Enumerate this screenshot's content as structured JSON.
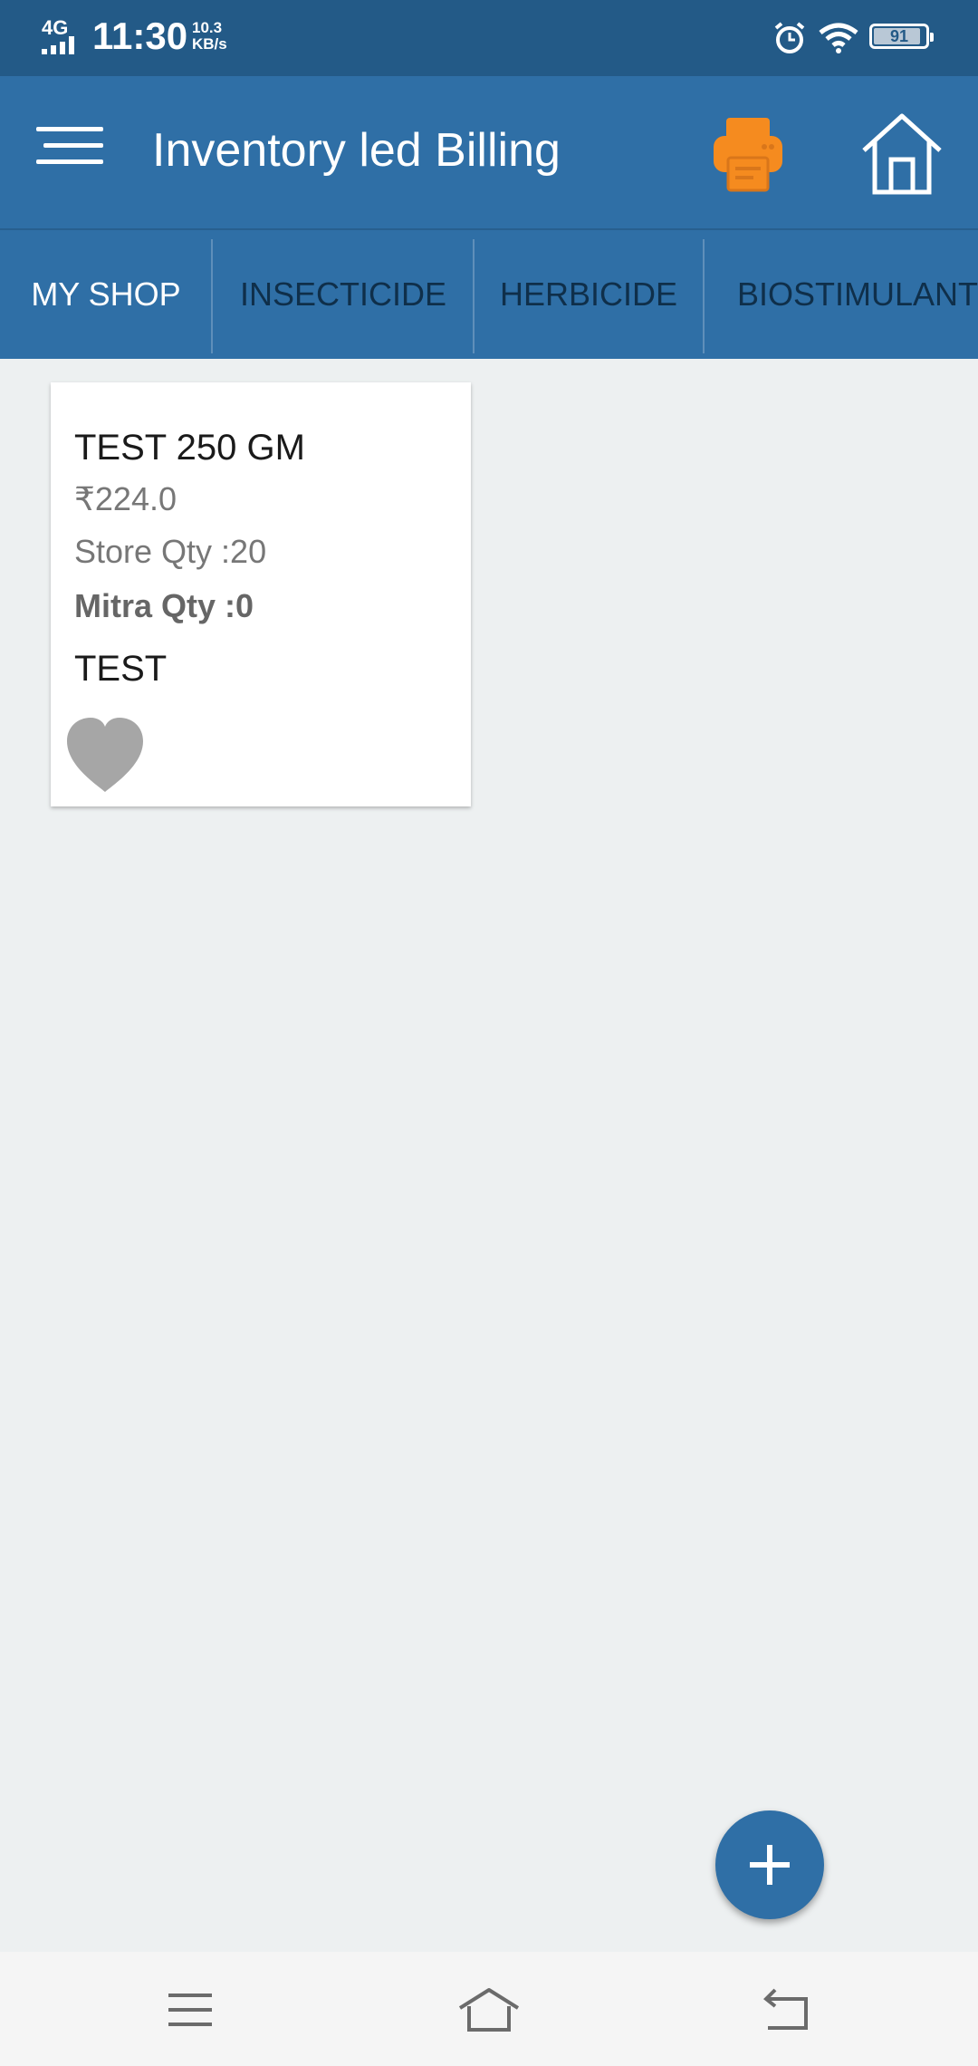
{
  "status_bar": {
    "network": "4G",
    "time": "11:30",
    "speed_value": "10.3",
    "speed_unit": "KB/s",
    "battery": "91",
    "battery_level": 0.91,
    "icons": [
      "signal-icon",
      "alarm-icon",
      "wifi-icon",
      "battery-icon"
    ]
  },
  "app_bar": {
    "title": "Inventory led Billing",
    "icons": [
      "menu-icon",
      "printer-icon",
      "home-icon"
    ],
    "printer_color": "#f58b1f"
  },
  "tabs": [
    {
      "label": "MY SHOP",
      "active": true
    },
    {
      "label": "INSECTICIDE",
      "active": false
    },
    {
      "label": "HERBICIDE",
      "active": false
    },
    {
      "label": "BIOSTIMULANTS",
      "active": false
    }
  ],
  "products": [
    {
      "name": "TEST 250 GM",
      "price": "₹224.0",
      "store_qty": "Store Qty :20",
      "mitra_qty": "Mitra Qty :0",
      "brand": "TEST",
      "favorite_icon": "heart-icon"
    }
  ],
  "fab": {
    "icon": "plus-icon"
  },
  "nav_bar": {
    "icons": [
      "recent-apps-icon",
      "home-nav-icon",
      "back-icon"
    ]
  },
  "colors": {
    "primary": "#2f6fa6",
    "status_bar": "#235a87",
    "background": "#edf0f1",
    "accent": "#f58b1f"
  }
}
